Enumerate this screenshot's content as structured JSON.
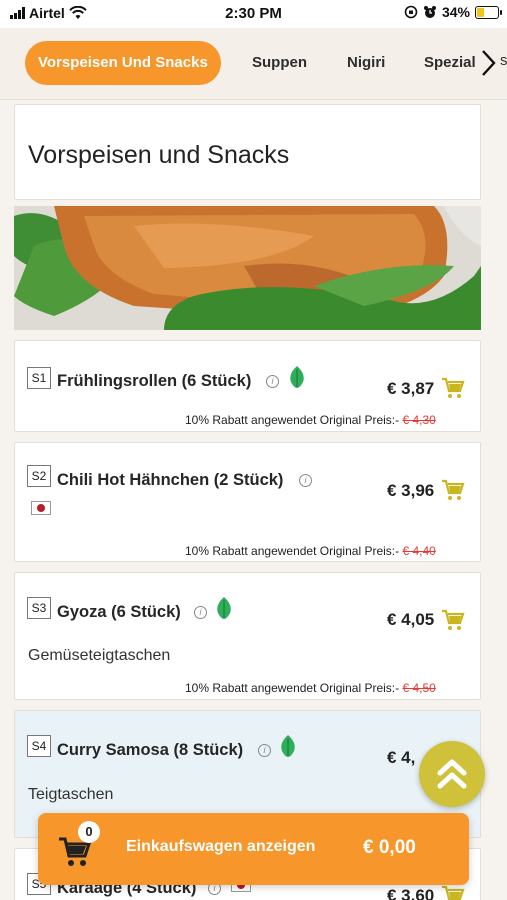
{
  "status_bar": {
    "carrier": "Airtel",
    "time": "2:30 PM",
    "battery": "34%",
    "battery_level": 0.34
  },
  "categories": {
    "tabs": [
      {
        "label": "Vorspeisen Und Snacks",
        "active": true
      },
      {
        "label": "Suppen",
        "active": false
      },
      {
        "label": "Nigiri",
        "active": false
      },
      {
        "label": "Spezial",
        "active": false
      },
      {
        "label": "s",
        "active": false
      }
    ]
  },
  "section": {
    "title": "Vorspeisen und Snacks"
  },
  "discount_text": "10% Rabatt angewendet Original Preis:-",
  "items": [
    {
      "code": "S1",
      "name": "Frühlingsrollen (6 Stück)",
      "price": "€ 3,87",
      "original_price": "€ 4,30",
      "vegetarian": true,
      "spicy_flag": false,
      "description": ""
    },
    {
      "code": "S2",
      "name": "Chili Hot Hähnchen (2 Stück)",
      "price": "€ 3,96",
      "original_price": "€ 4,40",
      "vegetarian": false,
      "spicy_flag": true,
      "description": ""
    },
    {
      "code": "S3",
      "name": "Gyoza (6 Stück)",
      "price": "€ 4,05",
      "original_price": "€ 4,50",
      "vegetarian": true,
      "spicy_flag": false,
      "description": "Gemüseteigtaschen"
    },
    {
      "code": "S4",
      "name": "Curry Samosa (8 Stück)",
      "price": "€ 4,",
      "original_price": "",
      "vegetarian": true,
      "spicy_flag": false,
      "description": "Teigtaschen"
    },
    {
      "code": "S5",
      "name": "Karaage (4 Stück)",
      "price": "€ 3,60",
      "original_price": "",
      "vegetarian": false,
      "spicy_flag": true,
      "description": ""
    }
  ],
  "cart": {
    "count": "0",
    "label": "Einkaufswagen anzeigen",
    "total": "€ 0,00"
  },
  "colors": {
    "accent": "#f7962b",
    "cart_icon": "#c9b61f",
    "veg_leaf": "#2fae5a",
    "strike_price": "#e53935",
    "scroll_button": "#cfc23a"
  }
}
